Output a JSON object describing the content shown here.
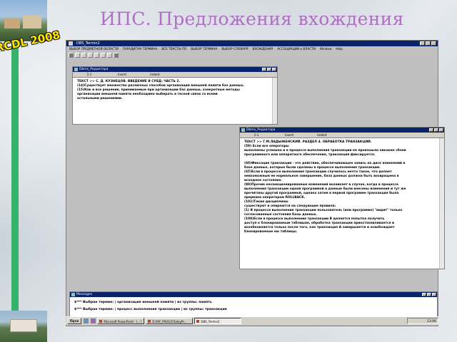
{
  "slide": {
    "title": "ИПС. Предложения вхождения",
    "badge": "RCDL 2008"
  },
  "app": {
    "title": "DBS_Termin2",
    "menu": [
      "ВЫБОР ПРЕДМЕТНОЙ ОБЛАСТИ",
      "ПАРАДИГМА ТЕРМИНА",
      "ВСЕ ТЕКСТЫ ПО",
      "ВЫБОР ТЕРМИНА",
      "ВЫБОР СЛОВАРЯ",
      "ВХОЖДЕНИЯ",
      "АССОЦИАЦИИ и ВЛАСТИ",
      "Window",
      "Help"
    ]
  },
  "window1": {
    "title": "Dbms_Редактора",
    "col1": "1:1",
    "col2": "Insert",
    "col3": "Indent",
    "lines": [
      "ТЕКСТ >> С. Д. КУЗНЕЦОВ. ВВЕДЕНИЕ В СУБД: ЧАСТЬ 2.",
      "(14)Существует множество различных способов организации внешней памяти баз данных.",
      "(15)Как и все решения, принимаемые при организации баз данных, конкретные методы",
      "организации внешней памяти необходимо выбирать в тесной связи со всеми",
      "остальными решениями."
    ]
  },
  "window2": {
    "title": "Dbms_Редактора",
    "col1": "1:1",
    "col2": "Insert",
    "col3": "Indent",
    "lines": [
      "ТЕКСТ >> Г.М.ЛАДЫЖЕНСКИЙ. РАЗДЕЛ 4. ОБРАБОТКА ТРАНЗАКЦИЙ.",
      "(59) Если все операторы",
      "выполнены успешно и в процессе выполнения транзакции не произошло никаких сбоев",
      "программного или аппаратного обеспечения, транзакция фиксируется.",
      "",
      "(60)Фиксация транзакции - это действие, обеспечивающее запись на диск изменений в",
      "базе данных, которые были сделаны в процессе выполнения транзакции.",
      "(65)Если в процессе выполнения транзакции случилось нечто такое, что делает",
      "невозможным ее нормальное завершение, база данных должна быть возвращена в",
      "исходное состояние.",
      "(98)Прочие несанкционированные изменений возникает в случае, когда в процессе",
      "выполнения транзакции одной программой в данные были внесены изменения и тут же",
      "прочитаны другой программой, однако затем в первой программе транзакция была",
      "прервана оператором ROLLBACK.",
      "(101)Такие дисциплины",
      "существуют и опираются на следующие правила:",
      "(1) В процессе выполнения транзакции пользователь (или программа) \"видит\" только",
      "согласованные состояния базы данных.",
      "(108)Если в процессе выполнения транзакции В делается попытка получить",
      "доступ к блокированным таблицам, обработка транзакции приостанавливается и",
      "возобновляется только после того, как транзакция A завершается и освобождает",
      "блокированные ею таблицы."
    ]
  },
  "messages": {
    "title": "Messages",
    "lines": [
      "$*** Выбран термин: | организация внешней памяти | из группы: память",
      "$*** Выбран термин: | процесс выполнения транзакции | из группы: транзакция"
    ]
  },
  "taskbar": {
    "start": "Пуск",
    "tasks": [
      "Microsoft PowerPoint - [...]",
      "D:\\MY_PROG2\\TodayPr...",
      "DBS_Termin2"
    ],
    "clock": "13:06"
  }
}
